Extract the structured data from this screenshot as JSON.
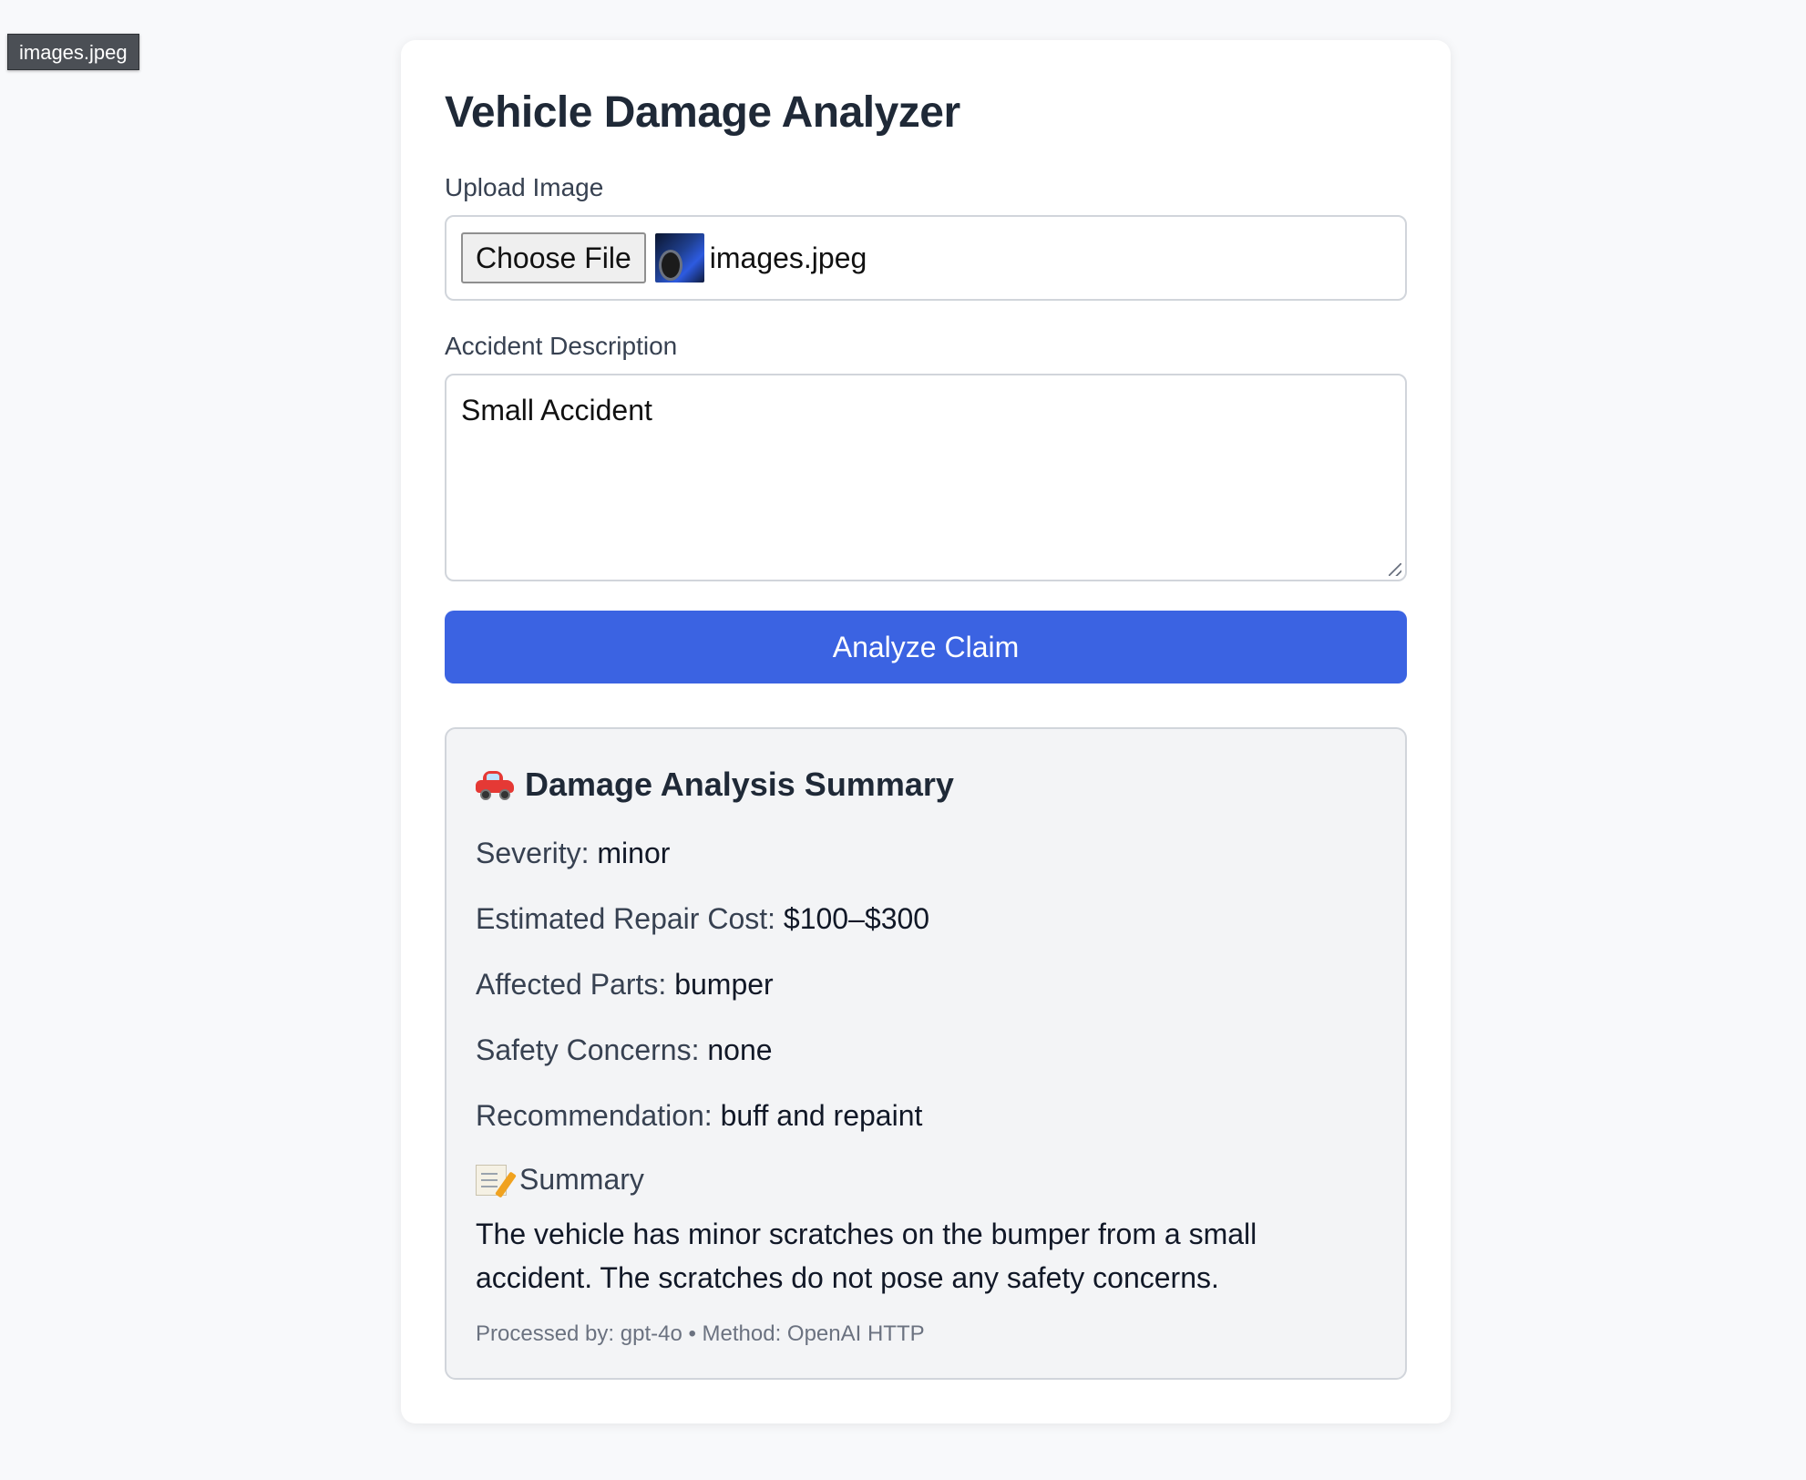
{
  "tooltip": {
    "text": "images.jpeg"
  },
  "header": {
    "title": "Vehicle Damage Analyzer"
  },
  "upload": {
    "label": "Upload Image",
    "button_label": "Choose File",
    "file_name": "images.jpeg"
  },
  "description": {
    "label": "Accident Description",
    "value": "Small Accident"
  },
  "actions": {
    "analyze_label": "Analyze Claim"
  },
  "result": {
    "title": "Damage Analysis Summary",
    "severity_label": "Severity:",
    "severity_value": "minor",
    "cost_label": "Estimated Repair Cost:",
    "cost_value": "$100–$300",
    "parts_label": "Affected Parts:",
    "parts_value": "bumper",
    "safety_label": "Safety Concerns:",
    "safety_value": "none",
    "recommendation_label": "Recommendation:",
    "recommendation_value": "buff and repaint",
    "summary_heading": "Summary",
    "summary_text": "The vehicle has minor scratches on the bumper from a small accident. The scratches do not pose any safety concerns.",
    "footer": "Processed by: gpt-4o • Method: OpenAI HTTP"
  },
  "icons": {
    "title_icon": "car-icon",
    "summary_icon": "memo-icon",
    "file_thumbnail": "image-thumbnail"
  },
  "colors": {
    "accent": "#3b63e2",
    "page_background": "#f8f9fb",
    "card_background": "#ffffff",
    "result_background": "#f3f4f6"
  }
}
